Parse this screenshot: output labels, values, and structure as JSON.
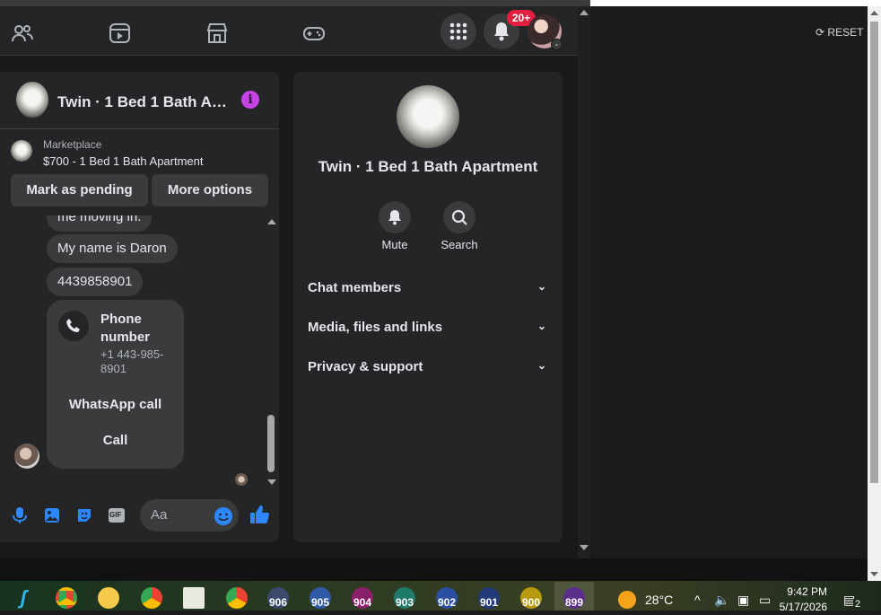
{
  "window": {
    "reset_label": "RESET",
    "reset_icon": "refresh-icon"
  },
  "topnav": {
    "icons": [
      "people-icon",
      "reels-icon",
      "marketplace-icon",
      "gaming-icon"
    ],
    "menu_icon": "grid-menu-icon",
    "notifications_icon": "bell-icon",
    "notifications_badge": "20+",
    "profile_icon": "avatar"
  },
  "chat": {
    "title": "Twin · 1 Bed 1 Bath Ap···",
    "info_icon": "i",
    "marketplace_label": "Marketplace",
    "listing": "$700 - 1 Bed 1 Bath Apartment",
    "mark_pending": "Mark as pending",
    "more_options": "More options",
    "messages": [
      "me moving in.",
      "My name is Daron",
      "4439858901"
    ],
    "phone_card": {
      "title": "Phone number",
      "number": "+1 443-985-8901",
      "whatsapp": "WhatsApp call",
      "call": "Call"
    },
    "composer_placeholder": "Aa",
    "composer_icons": [
      "mic-icon",
      "image-icon",
      "sticker-icon",
      "gif-icon",
      "emoji-icon",
      "like-icon"
    ],
    "gif_text": "GIF"
  },
  "info_panel": {
    "title": "Twin · 1 Bed 1 Bath Apartment",
    "mute": "Mute",
    "search": "Search",
    "sections": [
      "Chat members",
      "Media, files and links",
      "Privacy & support"
    ]
  },
  "taskbar": {
    "numbered_apps": [
      "906",
      "905",
      "904",
      "903",
      "902",
      "901",
      "900",
      "899"
    ],
    "temperature": "28°C",
    "time": "9:42 PM",
    "date": "5/17/2026",
    "notif_count": "2"
  },
  "colors": {
    "accent": "#c842e6",
    "badge": "#e41e3f",
    "blue": "#2d88ff"
  }
}
